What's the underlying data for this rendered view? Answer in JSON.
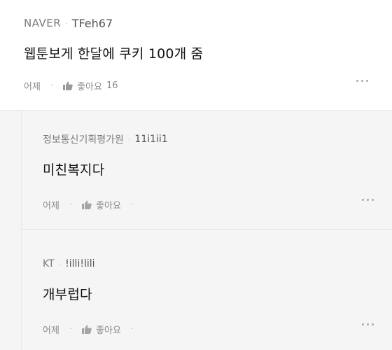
{
  "comment": {
    "source": "NAVER",
    "user": "TFeh67",
    "text": "웹툰보게 한달에 쿠키 100개 줌",
    "time": "어제",
    "like_label": "좋아요",
    "like_count": "16"
  },
  "replies": [
    {
      "source": "정보통신기획평가원",
      "user": "11i1ii1",
      "text": "미친복지다",
      "time": "어제",
      "like_label": "좋아요"
    },
    {
      "source": "KT",
      "user": "!illi!lili",
      "text": "개부럽다",
      "time": "어제",
      "like_label": "좋아요"
    }
  ],
  "icons": {
    "like": "thumbs-up-icon",
    "more": "more-options-icon"
  }
}
